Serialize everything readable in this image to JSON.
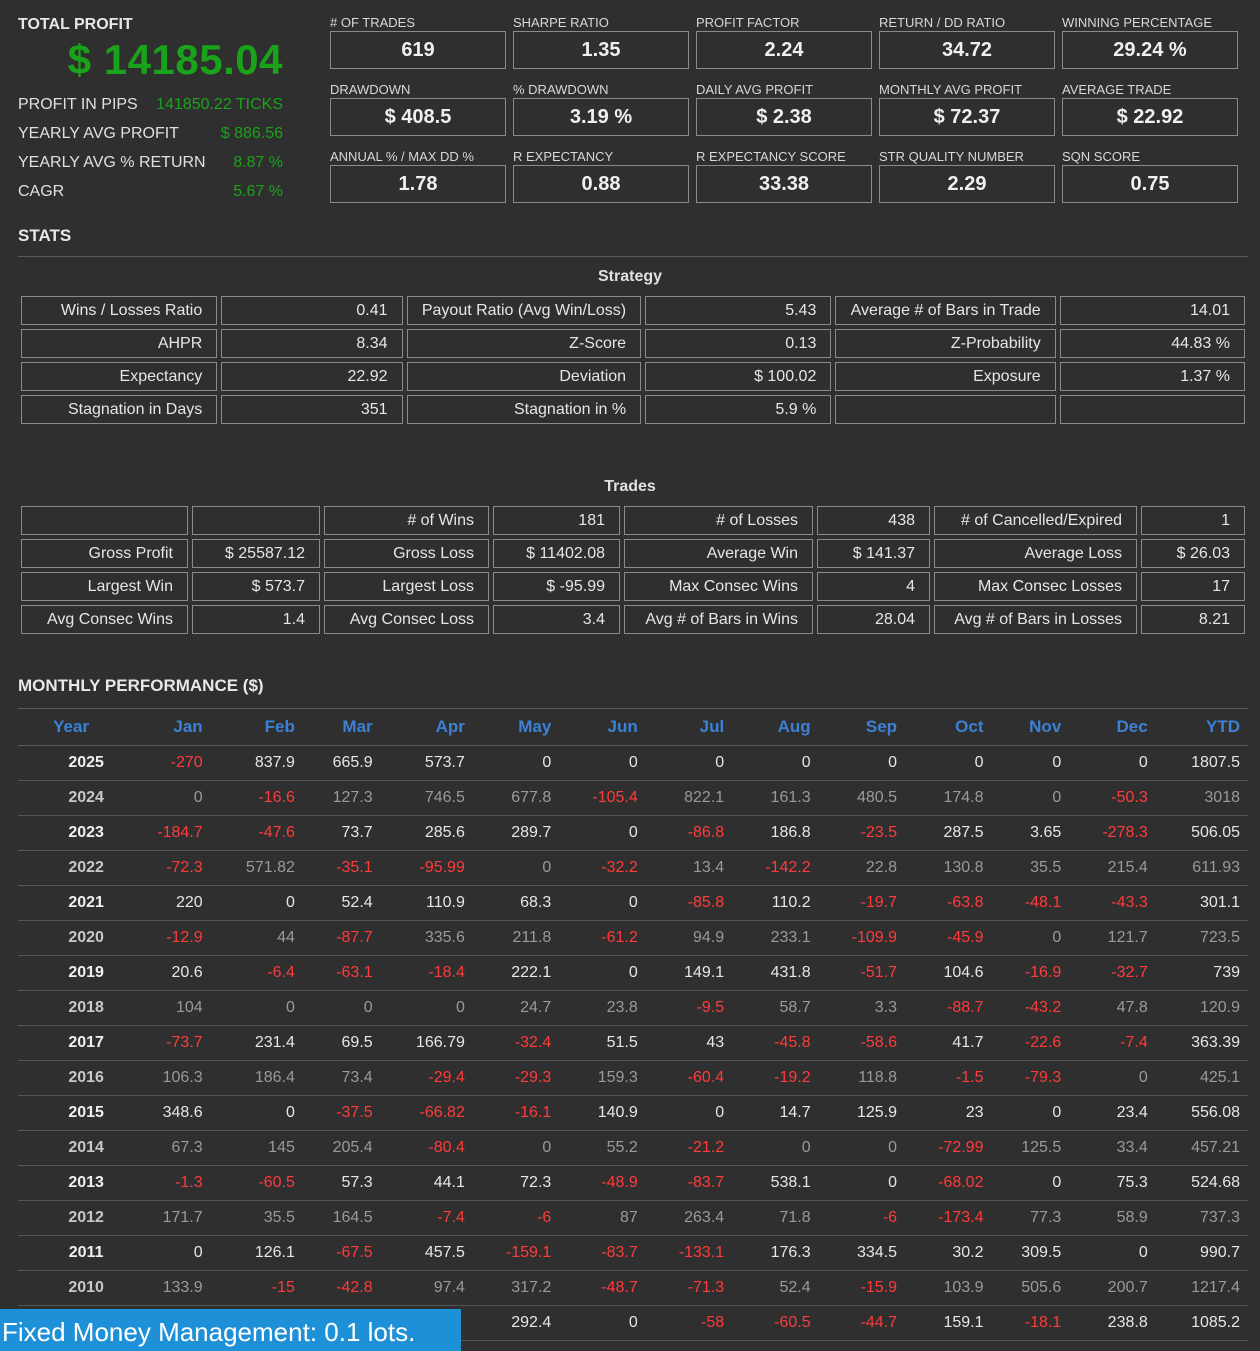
{
  "summary": {
    "total_profit_label": "TOTAL PROFIT",
    "total_profit_value": "$ 14185.04",
    "rows": [
      {
        "label": "PROFIT IN PIPS",
        "value": "141850.22 TICKS"
      },
      {
        "label": "YEARLY AVG PROFIT",
        "value": "$ 886.56"
      },
      {
        "label": "YEARLY AVG % RETURN",
        "value": "8.87 %"
      },
      {
        "label": "CAGR",
        "value": "5.67 %"
      }
    ]
  },
  "metrics": [
    {
      "label": "# OF TRADES",
      "value": "619"
    },
    {
      "label": "SHARPE RATIO",
      "value": "1.35"
    },
    {
      "label": "PROFIT FACTOR",
      "value": "2.24"
    },
    {
      "label": "RETURN / DD RATIO",
      "value": "34.72"
    },
    {
      "label": "WINNING PERCENTAGE",
      "value": "29.24 %"
    },
    {
      "label": "DRAWDOWN",
      "value": "$ 408.5"
    },
    {
      "label": "% DRAWDOWN",
      "value": "3.19 %"
    },
    {
      "label": "DAILY AVG PROFIT",
      "value": "$ 2.38"
    },
    {
      "label": "MONTHLY AVG PROFIT",
      "value": "$ 72.37"
    },
    {
      "label": "AVERAGE TRADE",
      "value": "$ 22.92"
    },
    {
      "label": "ANNUAL % / MAX DD %",
      "value": "1.78"
    },
    {
      "label": "R EXPECTANCY",
      "value": "0.88"
    },
    {
      "label": "R EXPECTANCY SCORE",
      "value": "33.38"
    },
    {
      "label": "STR QUALITY NUMBER",
      "value": "2.29"
    },
    {
      "label": "SQN SCORE",
      "value": "0.75"
    }
  ],
  "stats_title": "STATS",
  "strategy": {
    "title": "Strategy",
    "rows": [
      [
        "Wins / Losses Ratio",
        "0.41",
        "Payout Ratio (Avg Win/Loss)",
        "5.43",
        "Average # of Bars in Trade",
        "14.01"
      ],
      [
        "AHPR",
        "8.34",
        "Z-Score",
        "0.13",
        "Z-Probability",
        "44.83 %"
      ],
      [
        "Expectancy",
        "22.92",
        "Deviation",
        "$ 100.02",
        "Exposure",
        "1.37 %"
      ],
      [
        "Stagnation in Days",
        "351",
        "Stagnation in %",
        "5.9 %",
        "",
        ""
      ]
    ]
  },
  "trades": {
    "title": "Trades",
    "rows": [
      [
        "",
        "",
        "# of Wins",
        "181",
        "# of Losses",
        "438",
        "# of Cancelled/Expired",
        "1"
      ],
      [
        "Gross Profit",
        "$ 25587.12",
        "Gross Loss",
        "$ 11402.08",
        "Average Win",
        "$ 141.37",
        "Average Loss",
        "$ 26.03"
      ],
      [
        "Largest Win",
        "$ 573.7",
        "Largest Loss",
        "$ -95.99",
        "Max Consec Wins",
        "4",
        "Max Consec Losses",
        "17"
      ],
      [
        "Avg Consec Wins",
        "1.4",
        "Avg Consec Loss",
        "3.4",
        "Avg # of Bars in Wins",
        "28.04",
        "Avg # of Bars in Losses",
        "8.21"
      ]
    ]
  },
  "monthly": {
    "title": "MONTHLY PERFORMANCE ($)",
    "headers": [
      "Year",
      "Jan",
      "Feb",
      "Mar",
      "Apr",
      "May",
      "Jun",
      "Jul",
      "Aug",
      "Sep",
      "Oct",
      "Nov",
      "Dec",
      "YTD"
    ],
    "rows": [
      [
        "2025",
        "-270",
        "837.9",
        "665.9",
        "573.7",
        "0",
        "0",
        "0",
        "0",
        "0",
        "0",
        "0",
        "0",
        "1807.5"
      ],
      [
        "2024",
        "0",
        "-16.6",
        "127.3",
        "746.5",
        "677.8",
        "-105.4",
        "822.1",
        "161.3",
        "480.5",
        "174.8",
        "0",
        "-50.3",
        "3018"
      ],
      [
        "2023",
        "-184.7",
        "-47.6",
        "73.7",
        "285.6",
        "289.7",
        "0",
        "-86.8",
        "186.8",
        "-23.5",
        "287.5",
        "3.65",
        "-278.3",
        "506.05"
      ],
      [
        "2022",
        "-72.3",
        "571.82",
        "-35.1",
        "-95.99",
        "0",
        "-32.2",
        "13.4",
        "-142.2",
        "22.8",
        "130.8",
        "35.5",
        "215.4",
        "611.93"
      ],
      [
        "2021",
        "220",
        "0",
        "52.4",
        "110.9",
        "68.3",
        "0",
        "-85.8",
        "110.2",
        "-19.7",
        "-63.8",
        "-48.1",
        "-43.3",
        "301.1"
      ],
      [
        "2020",
        "-12.9",
        "44",
        "-87.7",
        "335.6",
        "211.8",
        "-61.2",
        "94.9",
        "233.1",
        "-109.9",
        "-45.9",
        "0",
        "121.7",
        "723.5"
      ],
      [
        "2019",
        "20.6",
        "-6.4",
        "-63.1",
        "-18.4",
        "222.1",
        "0",
        "149.1",
        "431.8",
        "-51.7",
        "104.6",
        "-16.9",
        "-32.7",
        "739"
      ],
      [
        "2018",
        "104",
        "0",
        "0",
        "0",
        "24.7",
        "23.8",
        "-9.5",
        "58.7",
        "3.3",
        "-88.7",
        "-43.2",
        "47.8",
        "120.9"
      ],
      [
        "2017",
        "-73.7",
        "231.4",
        "69.5",
        "166.79",
        "-32.4",
        "51.5",
        "43",
        "-45.8",
        "-58.6",
        "41.7",
        "-22.6",
        "-7.4",
        "363.39"
      ],
      [
        "2016",
        "106.3",
        "186.4",
        "73.4",
        "-29.4",
        "-29.3",
        "159.3",
        "-60.4",
        "-19.2",
        "118.8",
        "-1.5",
        "-79.3",
        "0",
        "425.1"
      ],
      [
        "2015",
        "348.6",
        "0",
        "-37.5",
        "-66.82",
        "-16.1",
        "140.9",
        "0",
        "14.7",
        "125.9",
        "23",
        "0",
        "23.4",
        "556.08"
      ],
      [
        "2014",
        "67.3",
        "145",
        "205.4",
        "-80.4",
        "0",
        "55.2",
        "-21.2",
        "0",
        "0",
        "-72.99",
        "125.5",
        "33.4",
        "457.21"
      ],
      [
        "2013",
        "-1.3",
        "-60.5",
        "57.3",
        "44.1",
        "72.3",
        "-48.9",
        "-83.7",
        "538.1",
        "0",
        "-68.02",
        "0",
        "75.3",
        "524.68"
      ],
      [
        "2012",
        "171.7",
        "35.5",
        "164.5",
        "-7.4",
        "-6",
        "87",
        "263.4",
        "71.8",
        "-6",
        "-173.4",
        "77.3",
        "58.9",
        "737.3"
      ],
      [
        "2011",
        "0",
        "126.1",
        "-67.5",
        "457.5",
        "-159.1",
        "-83.7",
        "-133.1",
        "176.3",
        "334.5",
        "30.2",
        "309.5",
        "0",
        "990.7"
      ],
      [
        "2010",
        "133.9",
        "-15",
        "-42.8",
        "97.4",
        "317.2",
        "-48.7",
        "-71.3",
        "52.4",
        "-15.9",
        "103.9",
        "505.6",
        "200.7",
        "1217.4"
      ],
      [
        "",
        "",
        "",
        "",
        "",
        "292.4",
        "0",
        "-58",
        "-60.5",
        "-44.7",
        "159.1",
        "-18.1",
        "238.8",
        "1085.2"
      ]
    ]
  },
  "banner": "Fixed Money Management: 0.1 lots."
}
